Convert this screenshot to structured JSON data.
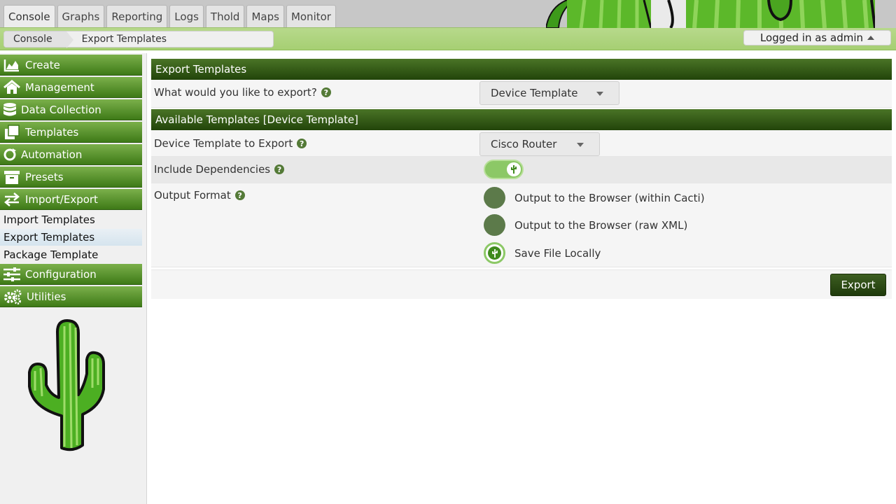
{
  "nav_tabs": [
    {
      "label": "Console"
    },
    {
      "label": "Graphs"
    },
    {
      "label": "Reporting"
    },
    {
      "label": "Logs"
    },
    {
      "label": "Thold"
    },
    {
      "label": "Maps"
    },
    {
      "label": "Monitor"
    }
  ],
  "breadcrumb": {
    "items": [
      "Console",
      "Export Templates"
    ]
  },
  "user": {
    "label": "Logged in as admin"
  },
  "sidebar": {
    "sections": [
      {
        "label": "Create",
        "icon": "area-chart-icon"
      },
      {
        "label": "Management",
        "icon": "home-icon"
      },
      {
        "label": "Data Collection",
        "icon": "database-icon"
      },
      {
        "label": "Templates",
        "icon": "clone-icon"
      },
      {
        "label": "Automation",
        "icon": "refresh-icon"
      },
      {
        "label": "Presets",
        "icon": "archive-icon"
      },
      {
        "label": "Import/Export",
        "icon": "exchange-icon"
      },
      {
        "label": "Configuration",
        "icon": "sliders-icon"
      },
      {
        "label": "Utilities",
        "icon": "cogs-icon"
      }
    ],
    "import_export_items": [
      "Import Templates",
      "Export Templates",
      "Package Template"
    ]
  },
  "panel1": {
    "title": "Export Templates",
    "question_label": "What would you like to export?",
    "select_value": "Device Template"
  },
  "panel2": {
    "title": "Available Templates [Device Template]",
    "device_label": "Device Template to Export",
    "device_value": "Cisco Router",
    "dependencies_label": "Include Dependencies",
    "dependencies_on": true,
    "output_label": "Output Format",
    "output_options": [
      {
        "label": "Output to the Browser (within Cacti)",
        "checked": false
      },
      {
        "label": "Output to the Browser (raw XML)",
        "checked": false
      },
      {
        "label": "Save File Locally",
        "checked": true
      }
    ]
  },
  "actions": {
    "export_label": "Export"
  },
  "colors": {
    "header_green": "#3e7a17",
    "accent_green": "#8cc866",
    "dark_button": "#2c4a14"
  }
}
